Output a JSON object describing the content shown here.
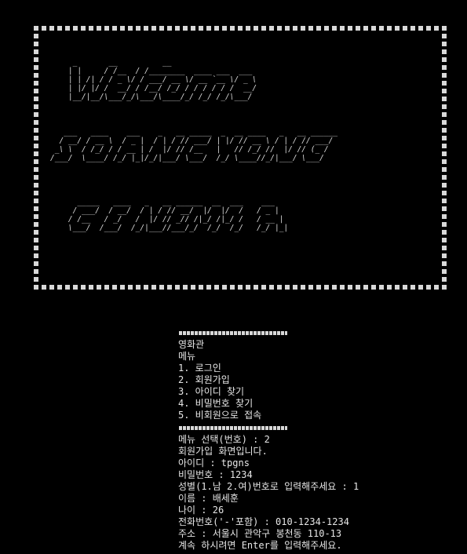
{
  "banner": {
    "line_1": "     _       __          __                        \n    | |     / /__  / /________  ____ ___  ___      \n    | | /| / / _ \\/ / ___/ __ \\/ __ `__ \\/ _ \\     \n    | |/ |/ /  __/ / /__/ /_/ / / / / / /  __/     \n    |__/|__/\\___/_/\\___/\\____/_/ /_/ /_/\\___/      ",
    "line_2": "   ___   ____    ___    _   __ _____  _  __ ____   _   __ ______\n  / __/ / __ \\  / _ |  / | / // ___/ | |/ // __ \\ / | / // ___/\n _\\ \\  / /_/ / / __ | /  |/ // /__   |   // /_/ //  |/ // (_ / \n/___/  \\____/ /_/ |_|/_/|___/ \\___/  /_/ \\____//_/|___/ \\___/  ",
    "line_3": "      _____   ____   _   __ ______  __  ___    ___ \n     / ___/  / __/  / | / // __/  |/  |/  /   / _ |\n    / /__   / _/   /  |/ // _// /|_/ /|_/ /   / __ |\n    \\___/  /___/  /_/|___//___/_/  /_/  /_/   /_/ |_|"
  },
  "console": {
    "line_0": "영화관",
    "line_1": "메뉴",
    "line_2": "1. 로그인",
    "line_3": "2. 회원가입",
    "line_4": "3. 아이디 찾기",
    "line_5": "4. 비밀번호 찾기",
    "line_6": "5. 비회원으로 접속",
    "line_7": "메뉴 선택(번호) : 2",
    "line_8": "회원가입 화면입니다.",
    "line_9": "아이디 : tpgns",
    "line_10": "비밀번호 : 1234",
    "line_11": "성별(1.남 2.여)번호로 입력해주세요 : 1",
    "line_12": "이름 : 배세훈",
    "line_13": "나이 : 26",
    "line_14": "전화번호('-'포함) : 010-1234-1234",
    "line_15": "주소 : 서울시 관악구 봉천동 110-13",
    "line_16": "계속 하시려면 Enter를 입력해주세요."
  },
  "colors": {
    "background": "#000000",
    "text": "#e6e6e6",
    "frame_square": "#d8d8d8"
  }
}
